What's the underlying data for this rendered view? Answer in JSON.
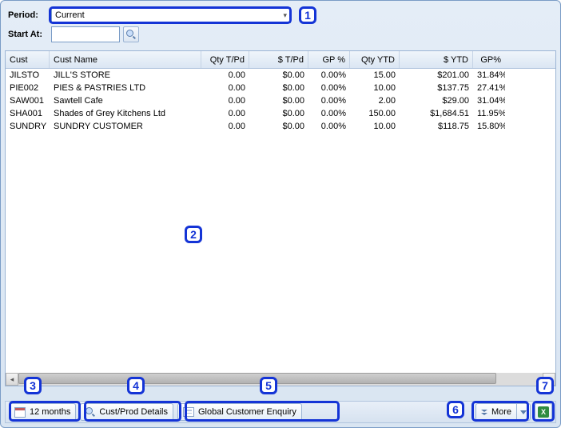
{
  "filters": {
    "period_label": "Period:",
    "period_value": "Current",
    "startat_label": "Start At:",
    "startat_value": ""
  },
  "columns": {
    "cust": "Cust",
    "custname": "Cust Name",
    "qtytpd": "Qty T/Pd",
    "stpd": "$ T/Pd",
    "gp": "GP %",
    "qtyytd": "Qty YTD",
    "sytd": "$ YTD",
    "gpytd": "GP%"
  },
  "rows": [
    {
      "cust": "JILSTO",
      "name": "JILL'S STORE",
      "qtytpd": "0.00",
      "stpd": "$0.00",
      "gp": "0.00%",
      "qtyytd": "15.00",
      "sytd": "$201.00",
      "gpytd": "31.84%"
    },
    {
      "cust": "PIE002",
      "name": "PIES & PASTRIES LTD",
      "qtytpd": "0.00",
      "stpd": "$0.00",
      "gp": "0.00%",
      "qtyytd": "10.00",
      "sytd": "$137.75",
      "gpytd": "27.41%"
    },
    {
      "cust": "SAW001",
      "name": "Sawtell Cafe",
      "qtytpd": "0.00",
      "stpd": "$0.00",
      "gp": "0.00%",
      "qtyytd": "2.00",
      "sytd": "$29.00",
      "gpytd": "31.04%"
    },
    {
      "cust": "SHA001",
      "name": "Shades of Grey Kitchens Ltd",
      "qtytpd": "0.00",
      "stpd": "$0.00",
      "gp": "0.00%",
      "qtyytd": "150.00",
      "sytd": "$1,684.51",
      "gpytd": "11.95%"
    },
    {
      "cust": "SUNDRY",
      "name": "SUNDRY CUSTOMER",
      "qtytpd": "0.00",
      "stpd": "$0.00",
      "gp": "0.00%",
      "qtyytd": "10.00",
      "sytd": "$118.75",
      "gpytd": "15.80%"
    }
  ],
  "toolbar": {
    "twelve_months": "12 months",
    "cust_prod_details": "Cust/Prod Details",
    "global_enquiry": "Global Customer Enquiry",
    "more": "More"
  },
  "annotations": {
    "n1": "1",
    "n2": "2",
    "n3": "3",
    "n4": "4",
    "n5": "5",
    "n6": "6",
    "n7": "7"
  },
  "icons": {
    "excel_glyph": "X"
  }
}
